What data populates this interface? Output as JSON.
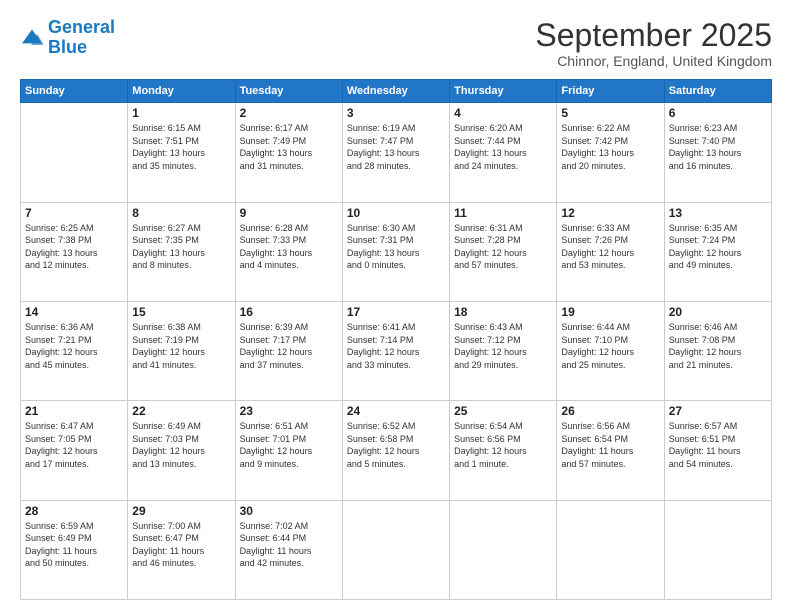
{
  "header": {
    "logo_line1": "General",
    "logo_line2": "Blue",
    "month": "September 2025",
    "location": "Chinnor, England, United Kingdom"
  },
  "weekdays": [
    "Sunday",
    "Monday",
    "Tuesday",
    "Wednesday",
    "Thursday",
    "Friday",
    "Saturday"
  ],
  "weeks": [
    [
      {
        "day": "",
        "text": ""
      },
      {
        "day": "1",
        "text": "Sunrise: 6:15 AM\nSunset: 7:51 PM\nDaylight: 13 hours\nand 35 minutes."
      },
      {
        "day": "2",
        "text": "Sunrise: 6:17 AM\nSunset: 7:49 PM\nDaylight: 13 hours\nand 31 minutes."
      },
      {
        "day": "3",
        "text": "Sunrise: 6:19 AM\nSunset: 7:47 PM\nDaylight: 13 hours\nand 28 minutes."
      },
      {
        "day": "4",
        "text": "Sunrise: 6:20 AM\nSunset: 7:44 PM\nDaylight: 13 hours\nand 24 minutes."
      },
      {
        "day": "5",
        "text": "Sunrise: 6:22 AM\nSunset: 7:42 PM\nDaylight: 13 hours\nand 20 minutes."
      },
      {
        "day": "6",
        "text": "Sunrise: 6:23 AM\nSunset: 7:40 PM\nDaylight: 13 hours\nand 16 minutes."
      }
    ],
    [
      {
        "day": "7",
        "text": "Sunrise: 6:25 AM\nSunset: 7:38 PM\nDaylight: 13 hours\nand 12 minutes."
      },
      {
        "day": "8",
        "text": "Sunrise: 6:27 AM\nSunset: 7:35 PM\nDaylight: 13 hours\nand 8 minutes."
      },
      {
        "day": "9",
        "text": "Sunrise: 6:28 AM\nSunset: 7:33 PM\nDaylight: 13 hours\nand 4 minutes."
      },
      {
        "day": "10",
        "text": "Sunrise: 6:30 AM\nSunset: 7:31 PM\nDaylight: 13 hours\nand 0 minutes."
      },
      {
        "day": "11",
        "text": "Sunrise: 6:31 AM\nSunset: 7:28 PM\nDaylight: 12 hours\nand 57 minutes."
      },
      {
        "day": "12",
        "text": "Sunrise: 6:33 AM\nSunset: 7:26 PM\nDaylight: 12 hours\nand 53 minutes."
      },
      {
        "day": "13",
        "text": "Sunrise: 6:35 AM\nSunset: 7:24 PM\nDaylight: 12 hours\nand 49 minutes."
      }
    ],
    [
      {
        "day": "14",
        "text": "Sunrise: 6:36 AM\nSunset: 7:21 PM\nDaylight: 12 hours\nand 45 minutes."
      },
      {
        "day": "15",
        "text": "Sunrise: 6:38 AM\nSunset: 7:19 PM\nDaylight: 12 hours\nand 41 minutes."
      },
      {
        "day": "16",
        "text": "Sunrise: 6:39 AM\nSunset: 7:17 PM\nDaylight: 12 hours\nand 37 minutes."
      },
      {
        "day": "17",
        "text": "Sunrise: 6:41 AM\nSunset: 7:14 PM\nDaylight: 12 hours\nand 33 minutes."
      },
      {
        "day": "18",
        "text": "Sunrise: 6:43 AM\nSunset: 7:12 PM\nDaylight: 12 hours\nand 29 minutes."
      },
      {
        "day": "19",
        "text": "Sunrise: 6:44 AM\nSunset: 7:10 PM\nDaylight: 12 hours\nand 25 minutes."
      },
      {
        "day": "20",
        "text": "Sunrise: 6:46 AM\nSunset: 7:08 PM\nDaylight: 12 hours\nand 21 minutes."
      }
    ],
    [
      {
        "day": "21",
        "text": "Sunrise: 6:47 AM\nSunset: 7:05 PM\nDaylight: 12 hours\nand 17 minutes."
      },
      {
        "day": "22",
        "text": "Sunrise: 6:49 AM\nSunset: 7:03 PM\nDaylight: 12 hours\nand 13 minutes."
      },
      {
        "day": "23",
        "text": "Sunrise: 6:51 AM\nSunset: 7:01 PM\nDaylight: 12 hours\nand 9 minutes."
      },
      {
        "day": "24",
        "text": "Sunrise: 6:52 AM\nSunset: 6:58 PM\nDaylight: 12 hours\nand 5 minutes."
      },
      {
        "day": "25",
        "text": "Sunrise: 6:54 AM\nSunset: 6:56 PM\nDaylight: 12 hours\nand 1 minute."
      },
      {
        "day": "26",
        "text": "Sunrise: 6:56 AM\nSunset: 6:54 PM\nDaylight: 11 hours\nand 57 minutes."
      },
      {
        "day": "27",
        "text": "Sunrise: 6:57 AM\nSunset: 6:51 PM\nDaylight: 11 hours\nand 54 minutes."
      }
    ],
    [
      {
        "day": "28",
        "text": "Sunrise: 6:59 AM\nSunset: 6:49 PM\nDaylight: 11 hours\nand 50 minutes."
      },
      {
        "day": "29",
        "text": "Sunrise: 7:00 AM\nSunset: 6:47 PM\nDaylight: 11 hours\nand 46 minutes."
      },
      {
        "day": "30",
        "text": "Sunrise: 7:02 AM\nSunset: 6:44 PM\nDaylight: 11 hours\nand 42 minutes."
      },
      {
        "day": "",
        "text": ""
      },
      {
        "day": "",
        "text": ""
      },
      {
        "day": "",
        "text": ""
      },
      {
        "day": "",
        "text": ""
      }
    ]
  ]
}
